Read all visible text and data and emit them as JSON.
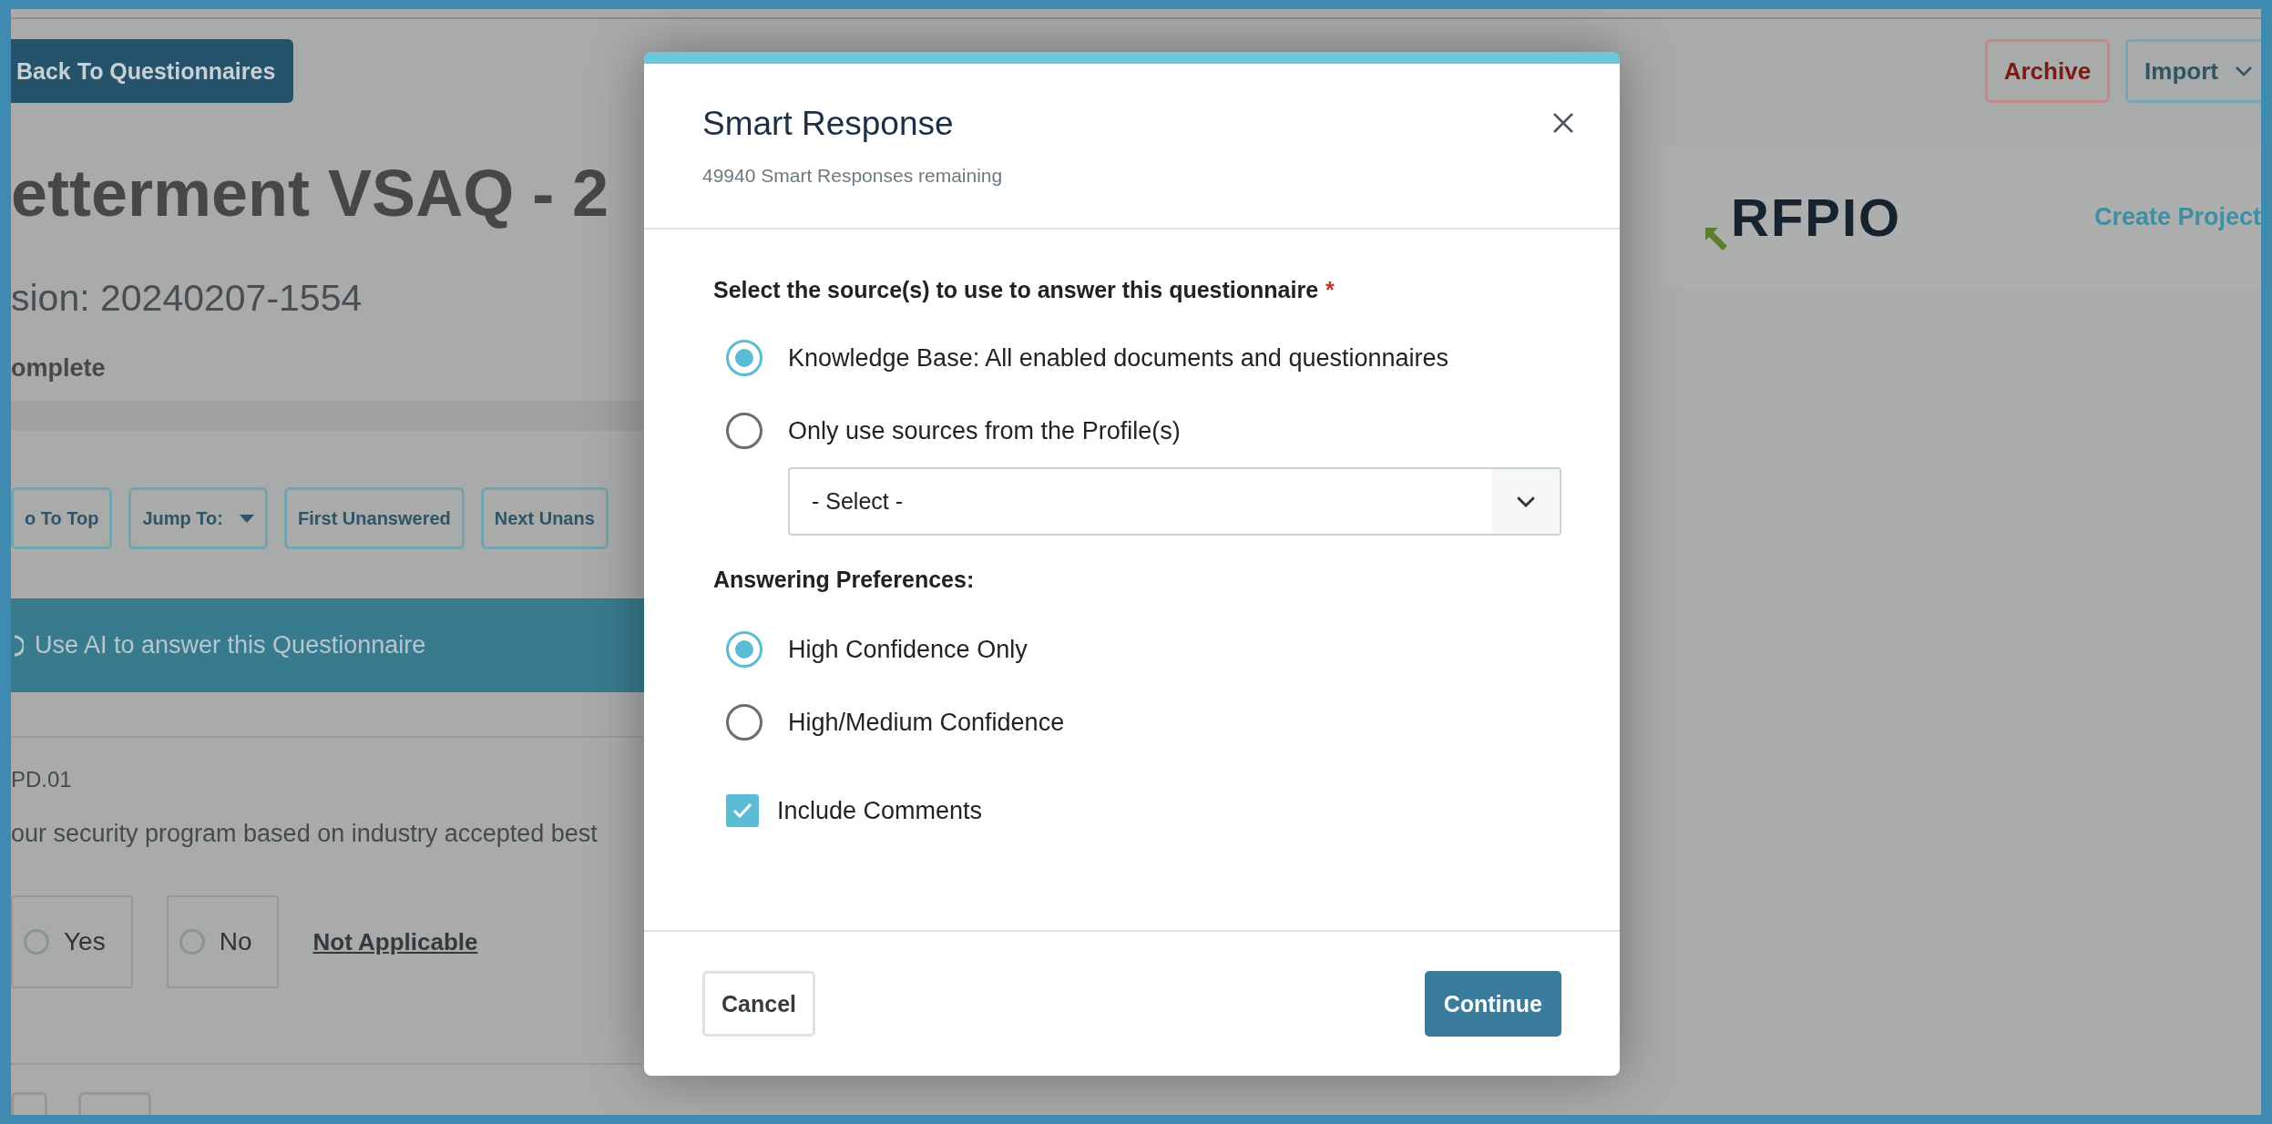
{
  "page": {
    "back_button": "Back To Questionnaires",
    "title": "etterment VSAQ - 2",
    "version": "sion: 20240207-1554",
    "status": "omplete",
    "toolbar": [
      {
        "label": "o To Top",
        "kind": "button"
      },
      {
        "label": "Jump To:",
        "kind": "dropdown"
      },
      {
        "label": "First Unanswered",
        "kind": "button"
      },
      {
        "label": "Next Unans",
        "kind": "button"
      }
    ],
    "ai_banner": "Use AI to answer this Questionnaire",
    "question": {
      "id": "PD.01",
      "text": "our security program based on industry accepted best",
      "options": [
        {
          "label": "Yes",
          "selected": false
        },
        {
          "label": "No",
          "selected": false
        }
      ],
      "not_applicable": "Not Applicable"
    },
    "header_buttons": [
      {
        "label": "Archive",
        "kind": "danger"
      },
      {
        "label": "Import",
        "kind": "dropdown"
      }
    ],
    "logo": "RFPIO",
    "create_project": "Create Project"
  },
  "dialog": {
    "title": "Smart Response",
    "subtitle": "49940 Smart Responses remaining",
    "source_prompt": "Select the source(s) to use to answer this questionnaire",
    "required_mark": "*",
    "sources": [
      {
        "label": "Knowledge Base: All enabled documents and questionnaires",
        "selected": true
      },
      {
        "label": "Only use sources from the Profile(s)",
        "selected": false
      }
    ],
    "profile_select": {
      "placeholder": "- Select -"
    },
    "preferences_label": "Answering Preferences:",
    "preferences": [
      {
        "label": "High Confidence Only",
        "selected": true
      },
      {
        "label": "High/Medium Confidence",
        "selected": false
      }
    ],
    "include_comments": {
      "label": "Include Comments",
      "checked": true
    },
    "buttons": [
      {
        "label": "Cancel",
        "kind": "secondary"
      },
      {
        "label": "Continue",
        "kind": "primary"
      }
    ]
  }
}
